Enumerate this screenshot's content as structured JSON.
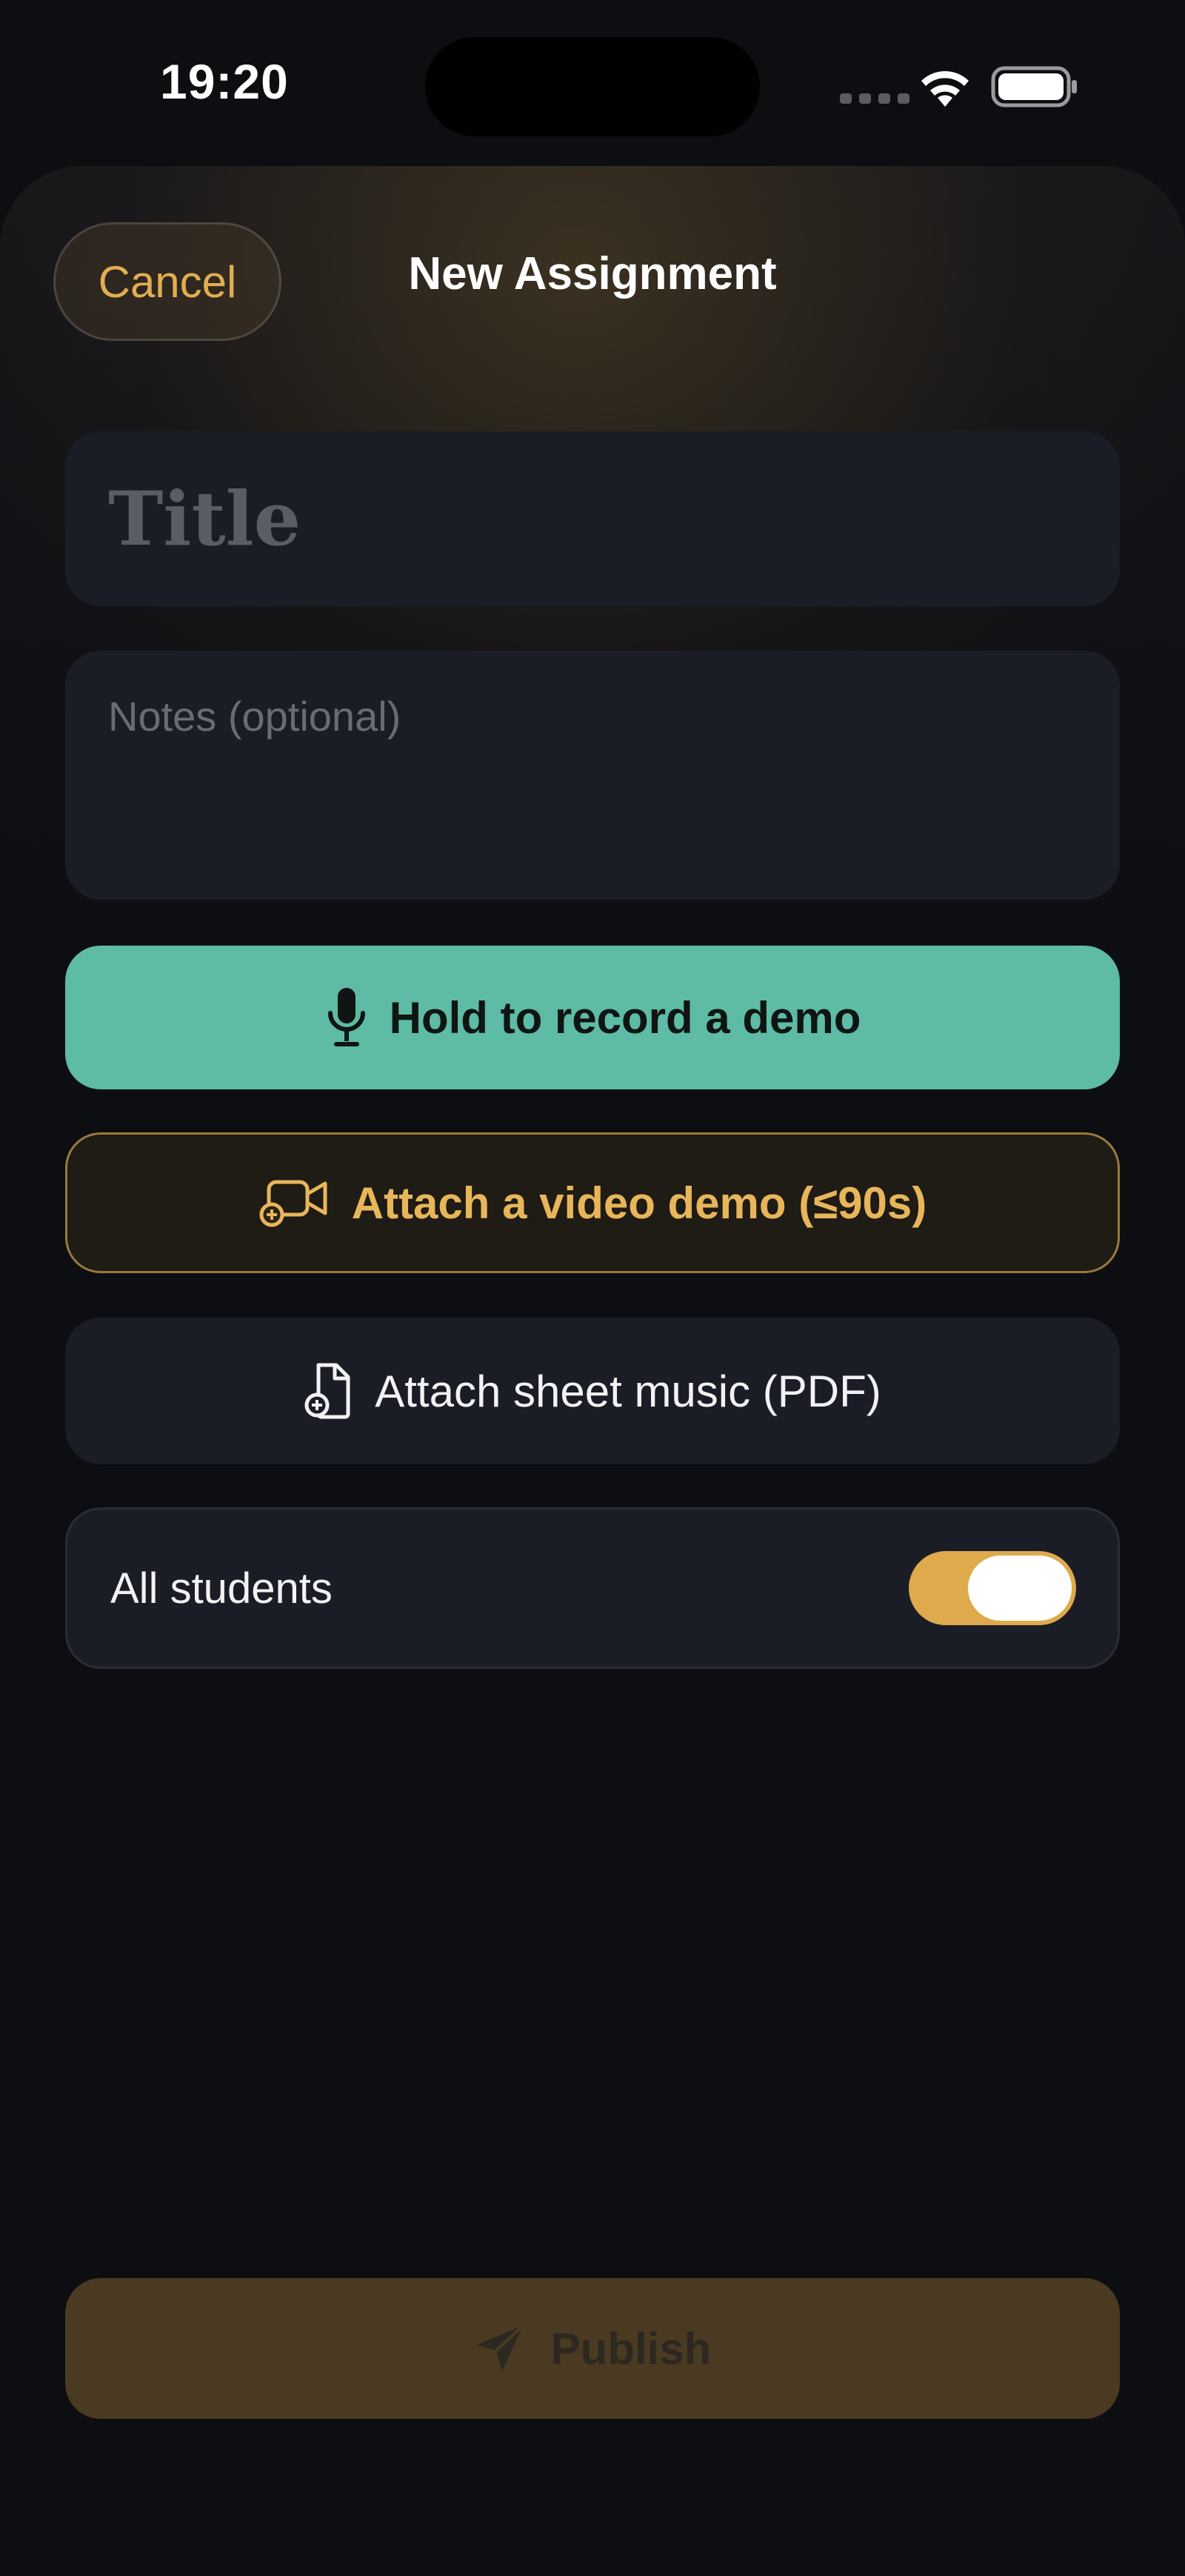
{
  "status_bar": {
    "time": "19:20",
    "icons": [
      "signal-dots-icon",
      "wifi-icon",
      "battery-icon"
    ]
  },
  "header": {
    "cancel_label": "Cancel",
    "title": "New Assignment"
  },
  "form": {
    "title_placeholder": "Title",
    "title_value": "",
    "notes_placeholder": "Notes (optional)",
    "notes_value": "",
    "record_label": "Hold to record a demo",
    "video_label": "Attach a video demo (≤90s)",
    "sheet_music_label": "Attach sheet music (PDF)",
    "all_students_label": "All students",
    "all_students_on": true
  },
  "footer": {
    "publish_label": "Publish",
    "publish_enabled": false
  },
  "colors": {
    "accent": "#e2ad52",
    "record": "#5dbba6",
    "field_bg": "#1b1d26",
    "background": "#0d0e12",
    "publish_disabled": "#4a3a22"
  }
}
